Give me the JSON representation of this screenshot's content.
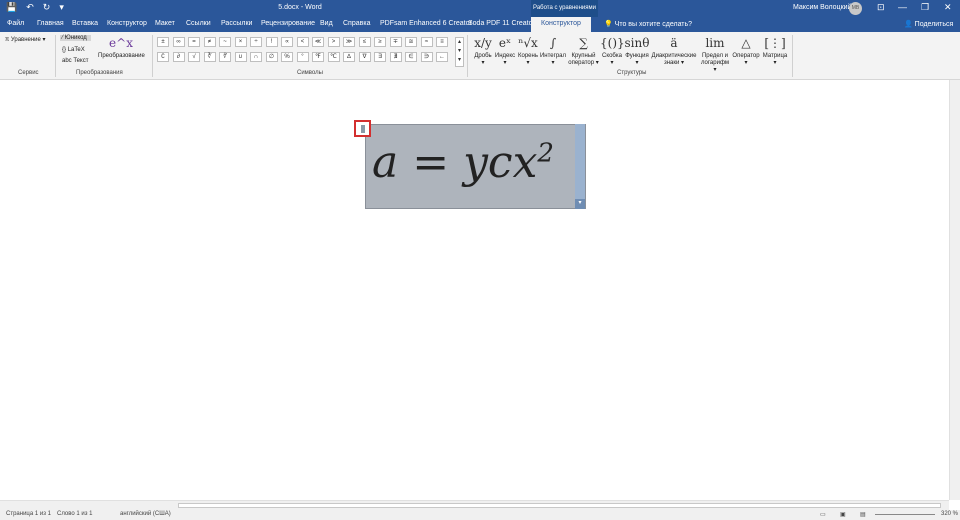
{
  "window": {
    "title": "5.docx - Word",
    "user": "Максим Волоцкий",
    "avatar_initials": "МВ",
    "context_header": "Работа с уравнениями"
  },
  "quick_access": {
    "save": "💾",
    "undo": "↶",
    "redo": "↻",
    "more": "▾"
  },
  "window_controls": {
    "ribbon_opts": "⊡",
    "minimize": "—",
    "maximize": "❐",
    "close": "✕"
  },
  "tabs": [
    "Файл",
    "Главная",
    "Вставка",
    "Конструктор",
    "Макет",
    "Ссылки",
    "Рассылки",
    "Рецензирование",
    "Вид",
    "Справка",
    "PDFsam Enhanced 6 Creator",
    "Soda PDF 11 Creator",
    "Конструктор"
  ],
  "tell_me": "Что вы хотите сделать?",
  "share": "Поделиться",
  "ribbon": {
    "service": {
      "label": "Сервис",
      "equation": "Уравнение"
    },
    "transform": {
      "label": "Преобразования",
      "unicode": "Юникод",
      "latex": "LaTeX",
      "text": "abc Текст",
      "convert": "Преобразование",
      "convert_icon": "e^x"
    },
    "symbols": {
      "label": "Символы",
      "row1": [
        "±",
        "∞",
        "=",
        "≠",
        "~",
        "×",
        "÷",
        "!",
        "∝",
        "<",
        "≪",
        ">",
        "≫",
        "≤",
        "≥",
        "∓",
        "≅",
        "≈",
        "≡"
      ],
      "row2": [
        "∁",
        "∂",
        "√",
        "∛",
        "∜",
        "∪",
        "∩",
        "∅",
        "%",
        "°",
        "℉",
        "℃",
        "∆",
        "∇",
        "∃",
        "∄",
        "∈",
        "∋",
        "←"
      ]
    },
    "structures": {
      "label": "Структуры",
      "items": [
        {
          "icon": "x/y",
          "label": "Дробь",
          "sub": "▾"
        },
        {
          "icon": "eˣ",
          "label": "Индекс",
          "sub": "▾"
        },
        {
          "icon": "ⁿ√x",
          "label": "Корень",
          "sub": "▾"
        },
        {
          "icon": "∫",
          "label": "Интеграл",
          "sub": "▾"
        },
        {
          "icon": "∑",
          "label": "Крупный",
          "sub": "оператор ▾"
        },
        {
          "icon": "{()}",
          "label": "Скобка",
          "sub": "▾"
        },
        {
          "icon": "sinθ",
          "label": "Функция",
          "sub": "▾"
        },
        {
          "icon": "ä",
          "label": "Диакритические",
          "sub": "знаки ▾"
        },
        {
          "icon": "lim",
          "label": "Предел и",
          "sub": "логарифм ▾"
        },
        {
          "icon": "△",
          "label": "Оператор",
          "sub": "▾"
        },
        {
          "icon": "[⋮]",
          "label": "Матрица",
          "sub": "▾"
        }
      ]
    }
  },
  "equation": {
    "main": "a = ycx",
    "exponent": "2"
  },
  "status": {
    "page": "Страница 1 из 1",
    "words": "Слово 1 из 1",
    "lang": "английский (США)",
    "zoom": "320 %"
  }
}
